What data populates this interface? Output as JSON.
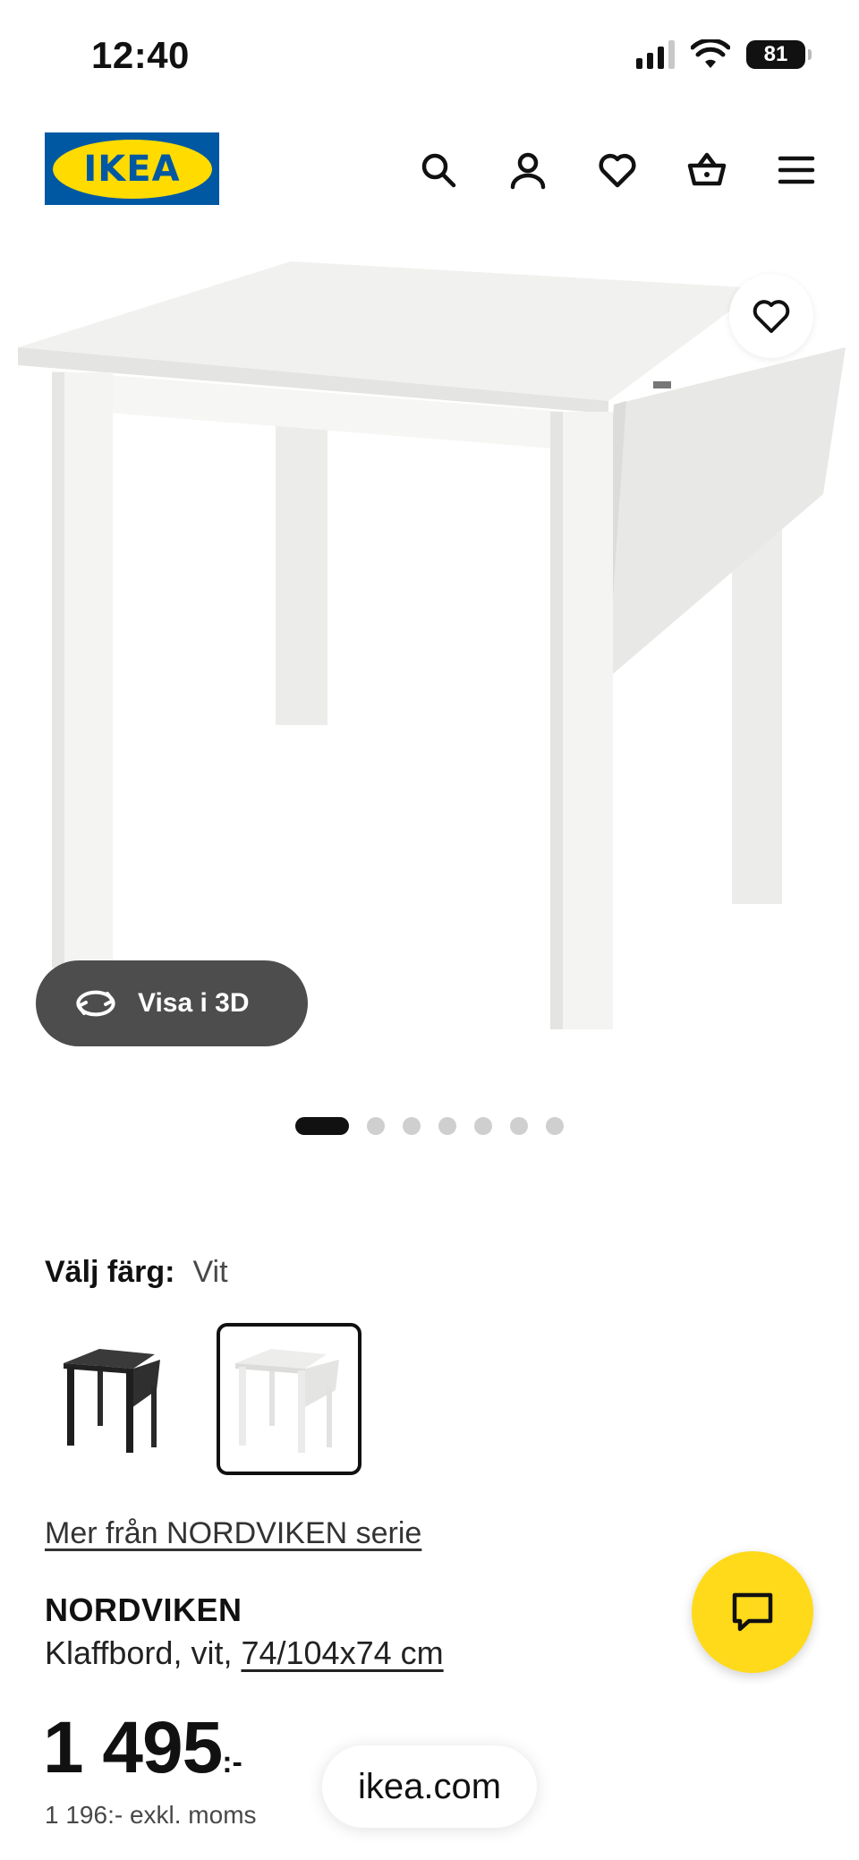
{
  "status_bar": {
    "time": "12:40",
    "battery": "81"
  },
  "header": {
    "logo_text": "IKEA",
    "icons": [
      "search-icon",
      "user-icon",
      "heart-icon",
      "basket-icon",
      "menu-icon"
    ]
  },
  "gallery": {
    "view_3d_label": "Visa i 3D",
    "dots_count": 7,
    "active_dot": 0
  },
  "color": {
    "label": "Välj färg:",
    "value": "Vit",
    "options": [
      "black-brown",
      "white"
    ],
    "selected": "white"
  },
  "series_link": "Mer från NORDVIKEN serie",
  "product": {
    "name": "NORDVIKEN",
    "description": "Klaffbord, vit,",
    "size": "74/104x74 cm"
  },
  "price": {
    "amount": "1 495",
    "suffix": ":-",
    "exkl": "1 196:- exkl. moms"
  },
  "browser": {
    "url": "ikea.com"
  },
  "colors": {
    "ikea_blue": "#0058a3",
    "ikea_yellow": "#ffdb00",
    "chat_yellow": "#ffda1a",
    "view3d_bg": "#4d4d4d"
  }
}
